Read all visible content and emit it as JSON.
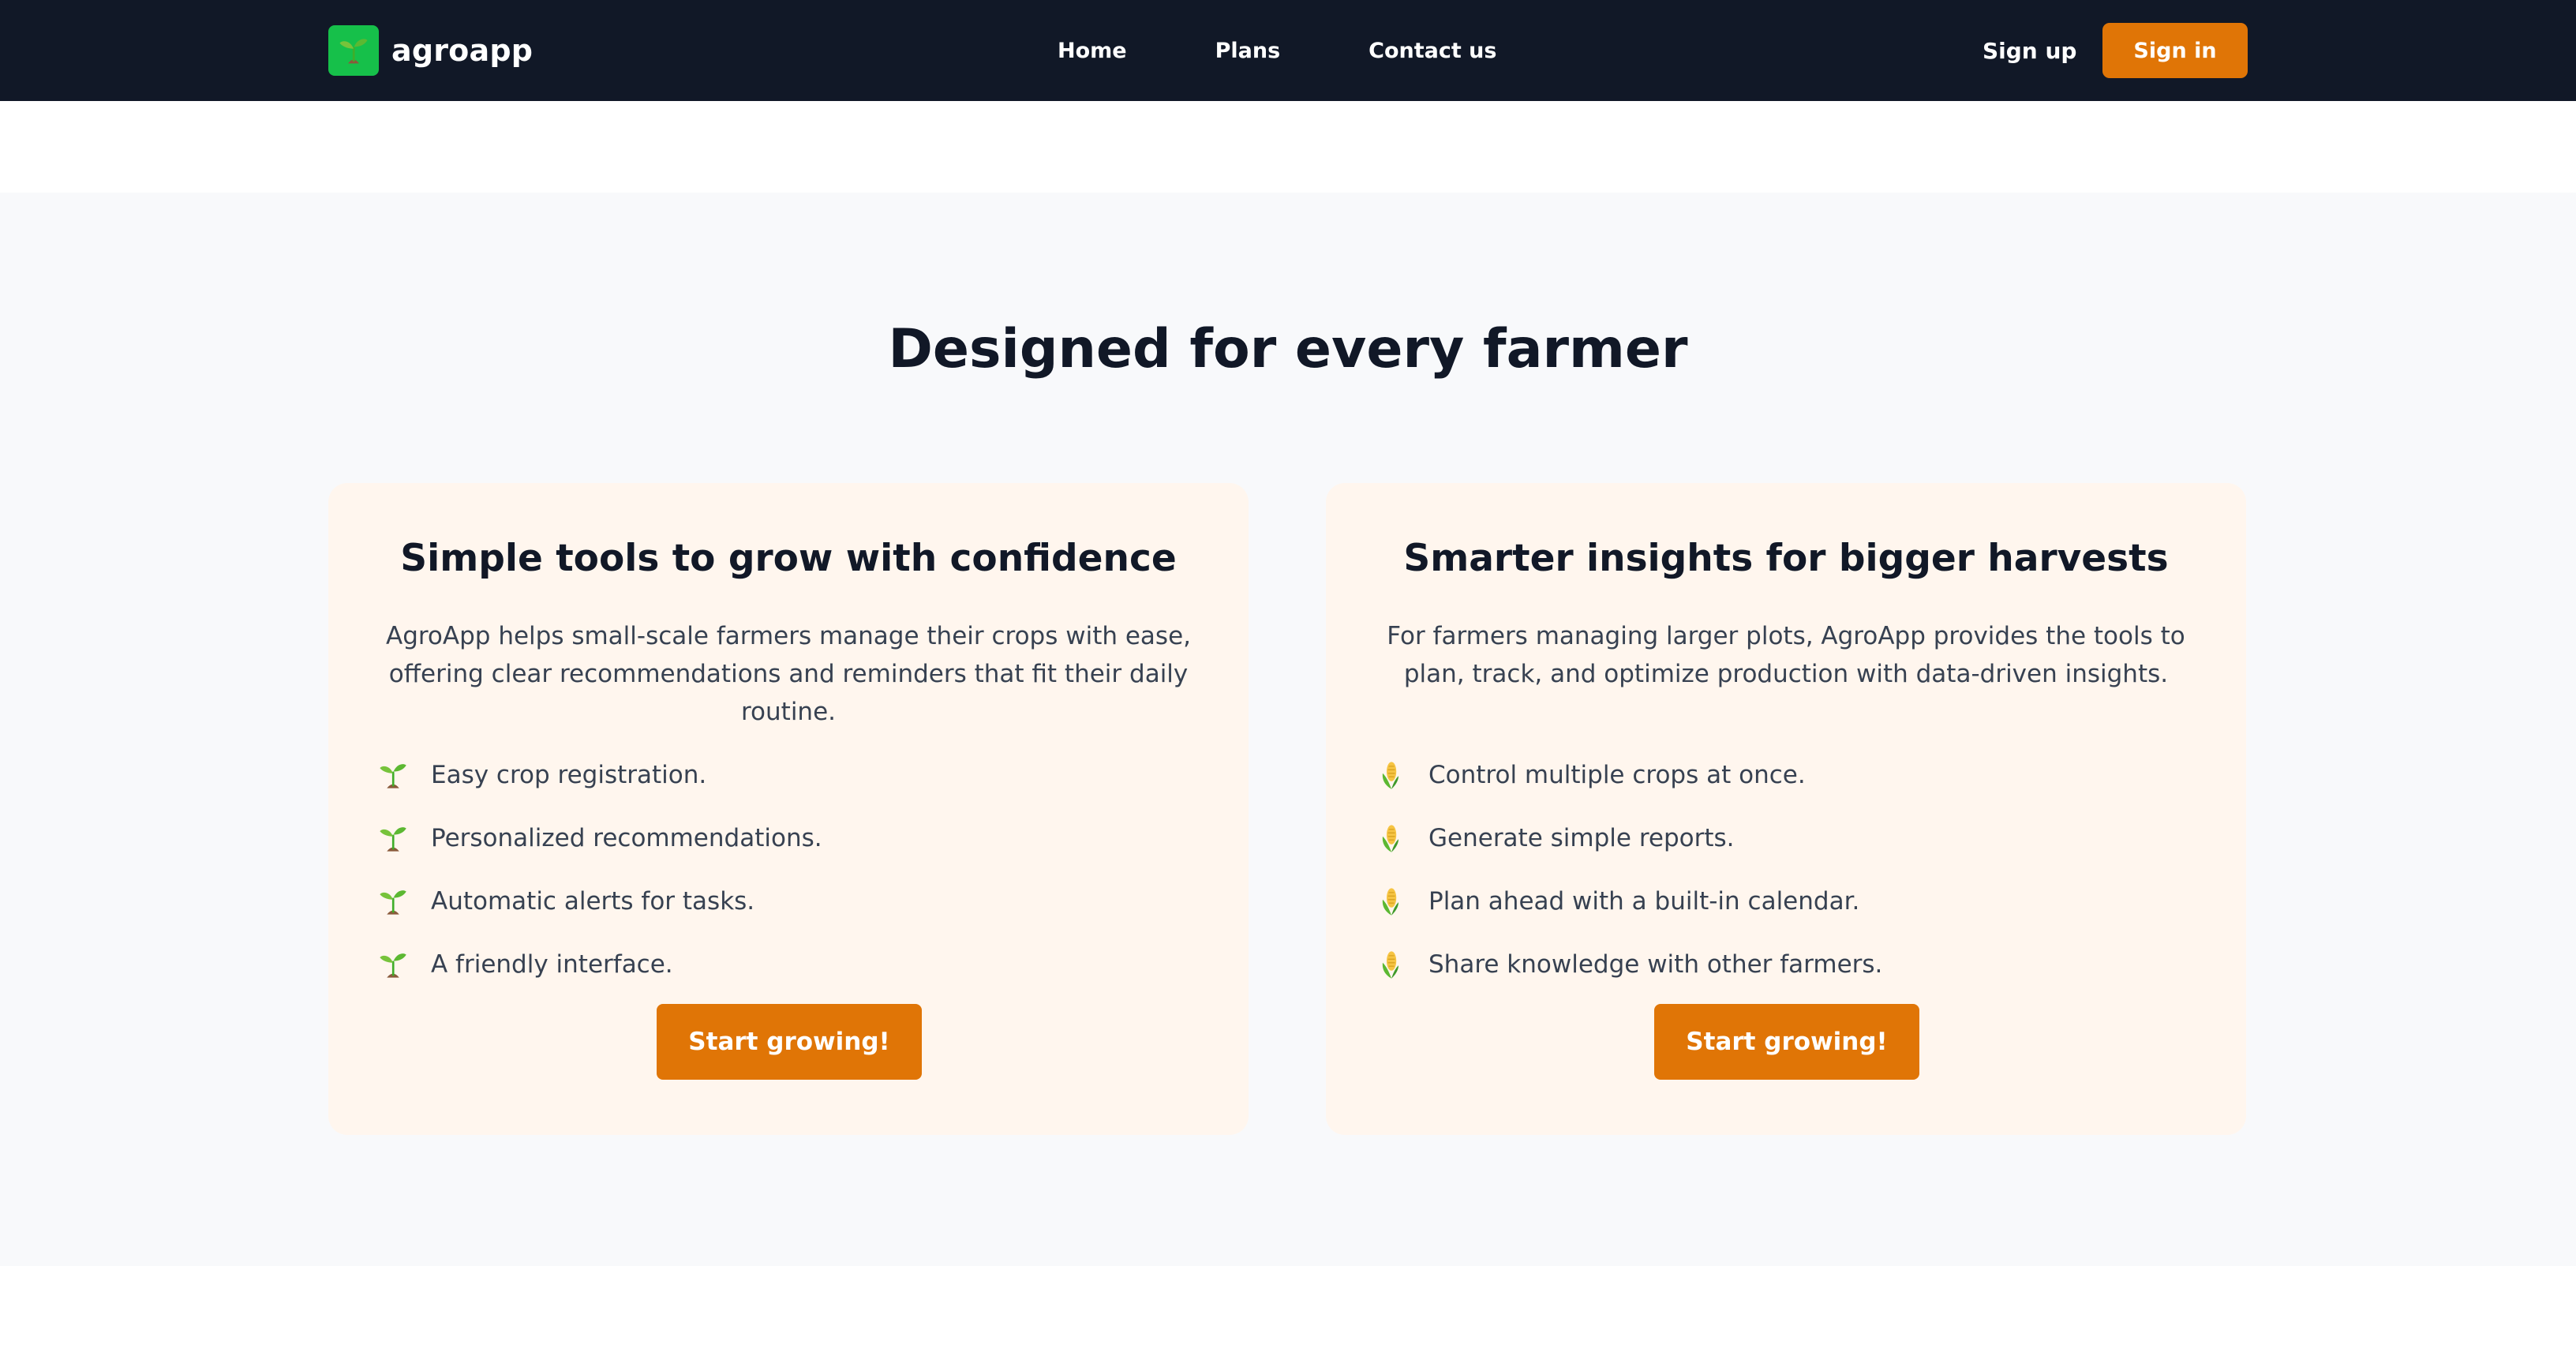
{
  "header": {
    "brand_name": "agroapp",
    "logo_icon": "seedling-icon",
    "nav_items": [
      {
        "label": "Home"
      },
      {
        "label": "Plans"
      },
      {
        "label": "Contact us"
      }
    ],
    "signup_label": "Sign up",
    "signin_label": "Sign in",
    "colors": {
      "header_bg": "#111827",
      "logo_bg": "#16c04a",
      "accent": "#e07506"
    }
  },
  "features": {
    "title": "Designed for every farmer",
    "background": "#f8f9fb",
    "card_background": "#fff6ee",
    "cards": [
      {
        "title": "Simple tools to grow with confidence",
        "description": "AgroApp helps small-scale farmers manage their crops with ease, offering clear recommendations and reminders that fit their daily routine.",
        "bullet_icon": "seedling-icon",
        "items": [
          "Easy crop registration.",
          "Personalized recommendations.",
          "Automatic alerts for tasks.",
          "A friendly interface."
        ],
        "cta_label": "Start growing!"
      },
      {
        "title": "Smarter insights for bigger harvests",
        "description": "For farmers managing larger plots, AgroApp provides the tools to plan, track, and optimize production with data-driven insights.",
        "bullet_icon": "corn-icon",
        "items": [
          "Control multiple crops at once.",
          "Generate simple reports.",
          "Plan ahead with a built-in calendar.",
          "Share knowledge with other farmers."
        ],
        "cta_label": "Start growing!"
      }
    ]
  }
}
